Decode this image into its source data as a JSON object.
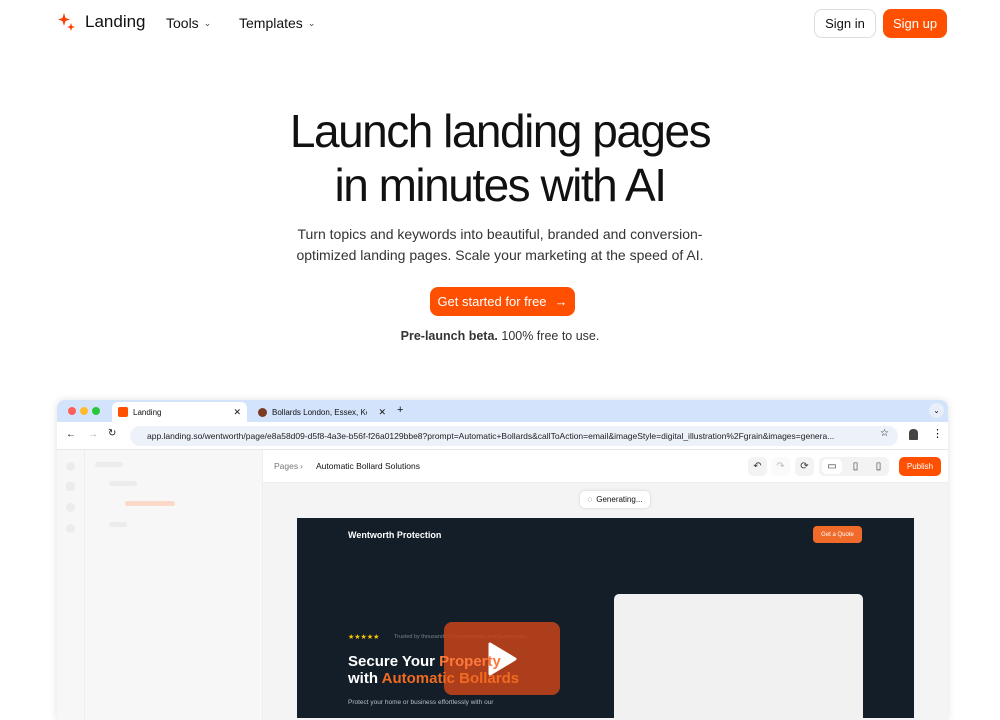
{
  "nav": {
    "brand": "Landing",
    "tools": "Tools",
    "templates": "Templates",
    "sign_in": "Sign in",
    "sign_up": "Sign up"
  },
  "hero": {
    "title_line1": "Launch landing pages",
    "title_line2": "in minutes with AI",
    "subtitle_line1": "Turn topics and keywords into beautiful, branded and conversion-",
    "subtitle_line2": "optimized landing pages. Scale your marketing at the speed of AI.",
    "cta": "Get started for free",
    "note_bold": "Pre-launch beta.",
    "note_rest": " 100% free to use."
  },
  "browser": {
    "tabs": [
      {
        "label": "Landing"
      },
      {
        "label": "Bollards London, Essex, Kent"
      }
    ],
    "url": "app.landing.so/wentworth/page/e8a58d09-d5f8-4a3e-b56f-f26a0129bbe8?prompt=Automatic+Bollards&callToAction=email&imageStyle=digital_illustration%2Fgrain&images=genera...",
    "breadcrumb": {
      "root": "Pages",
      "current": "Automatic Bollard Solutions"
    },
    "publish": "Publish",
    "status": "Generating...",
    "accent": "#ff4f00"
  },
  "preview": {
    "brand": "Wentworth Protection",
    "quote_button": "Get a Quote",
    "rating_stars": 5,
    "trust": "Trusted by thousands of homeowners and businesses",
    "headline_white": "Secure Your ",
    "headline_orange1": "Property",
    "headline_white2": "with ",
    "headline_orange2": "Automatic Bollards",
    "body": "Protect your home or business effortlessly with our"
  }
}
